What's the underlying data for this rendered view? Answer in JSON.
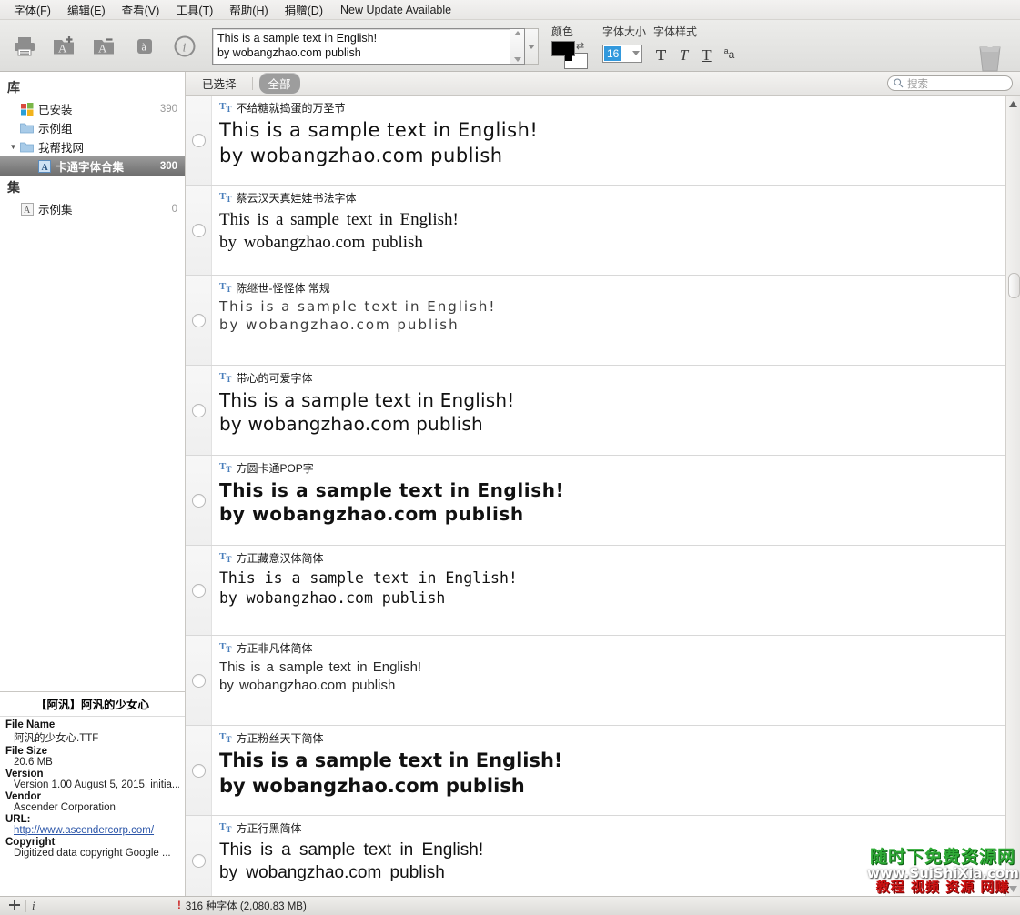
{
  "menu": {
    "items": [
      {
        "label": "字体(F)",
        "name": "menu-font"
      },
      {
        "label": "编辑(E)",
        "name": "menu-edit"
      },
      {
        "label": "查看(V)",
        "name": "menu-view"
      },
      {
        "label": "工具(T)",
        "name": "menu-tools"
      },
      {
        "label": "帮助(H)",
        "name": "menu-help"
      },
      {
        "label": "捐赠(D)",
        "name": "menu-donate"
      }
    ],
    "update_notice": "New Update Available"
  },
  "toolbar": {
    "icons": [
      {
        "name": "print-icon",
        "glyph": "print"
      },
      {
        "name": "add-font-folder-icon",
        "glyph": "folder-plus"
      },
      {
        "name": "remove-font-folder-icon",
        "glyph": "folder-minus"
      },
      {
        "name": "character-map-icon",
        "glyph": "glyph-a"
      },
      {
        "name": "info-icon",
        "glyph": "info"
      }
    ],
    "sample_input": {
      "line1": "This is a sample text in English!",
      "line2": "by wobangzhao.com  publish",
      "value": "This is a sample text in English!\nby wobangzhao.com  publish"
    },
    "color_label": "颜色",
    "color_fg": "#000000",
    "color_bg": "#ffffff",
    "size_label": "字体大小",
    "size_value": "16",
    "style_label": "字体样式",
    "style_buttons": [
      {
        "name": "bold-button",
        "label": "T"
      },
      {
        "name": "italic-button",
        "label": "T"
      },
      {
        "name": "underline-button",
        "label": "T"
      },
      {
        "name": "small-caps-button",
        "label": "a"
      }
    ],
    "trash_name": "trash-icon"
  },
  "sidebar": {
    "library_heading": "库",
    "library_items": [
      {
        "label": "已安装",
        "count": "390",
        "icon": "windows-icon",
        "indent": 1,
        "selected": false,
        "twisty": ""
      },
      {
        "label": "示例组",
        "count": "",
        "icon": "folder-icon",
        "indent": 1,
        "selected": false,
        "twisty": ""
      },
      {
        "label": "我帮找网",
        "count": "",
        "icon": "folder-icon",
        "indent": 1,
        "selected": false,
        "twisty": "▼"
      },
      {
        "label": "卡通字体合集",
        "count": "300",
        "icon": "font-file-icon",
        "indent": 2,
        "selected": true,
        "twisty": ""
      }
    ],
    "sets_heading": "集",
    "set_items": [
      {
        "label": "示例集",
        "count": "0",
        "icon": "font-set-icon",
        "indent": 1,
        "selected": false,
        "twisty": ""
      }
    ]
  },
  "info_panel": {
    "title": "【阿汎】阿汎的少女心",
    "fields": [
      {
        "key": "File Name",
        "value": "阿汎的少女心.TTF",
        "link": false
      },
      {
        "key": "File Size",
        "value": "20.6 MB",
        "link": false
      },
      {
        "key": "Version",
        "value": "Version 1.00 August 5, 2015, initia...",
        "link": false
      },
      {
        "key": "Vendor",
        "value": "Ascender Corporation",
        "link": false
      },
      {
        "key": "URL:",
        "value": "http://www.ascendercorp.com/",
        "link": true
      },
      {
        "key": "Copyright",
        "value": "Digitized data copyright Google ...",
        "link": false
      }
    ]
  },
  "content": {
    "tab_selected": "已选择",
    "tab_all": "全部",
    "search_placeholder": "搜索",
    "fonts": [
      {
        "name": "不给糖就捣蛋的万圣节",
        "preview_line1": "This is a sample text in English!",
        "preview_line2": "by wobangzhao.com  publish",
        "style": "pv-halloween"
      },
      {
        "name": "蔡云汉天真娃娃书法字体",
        "preview_line1": "This is a sample text in English!",
        "preview_line2": "by wobangzhao.com   publish",
        "style": "pv-serif"
      },
      {
        "name": "陈继世-怪怪体 常规",
        "preview_line1": "This is a sample text in English!",
        "preview_line2": "by wobangzhao.com  publish",
        "style": "pv-thin"
      },
      {
        "name": "带心的可爱字体",
        "preview_line1": "This is a sample text in English!",
        "preview_line2": "by wobangzhao.com  publish",
        "style": "pv-cute"
      },
      {
        "name": "方圆卡通POP字",
        "preview_line1": "This is a sample text in English!",
        "preview_line2": "by wobangzhao.com  publish",
        "style": "pv-pop"
      },
      {
        "name": "方正藏意汉体简体",
        "preview_line1": "This is a sample text in English!",
        "preview_line2": "by wobangzhao.com publish",
        "style": "pv-mono"
      },
      {
        "name": "方正非凡体简体",
        "preview_line1": "This is a sample text in English!",
        "preview_line2": "by wobangzhao.com   publish",
        "style": "pv-narrow"
      },
      {
        "name": "方正粉丝天下简体",
        "preview_line1": "This is a sample text in English!",
        "preview_line2": "by wobangzhao.com  publish",
        "style": "pv-bold"
      },
      {
        "name": "方正行黑简体",
        "preview_line1": "This is a sample text in English!",
        "preview_line2": "by wobangzhao.com   publish",
        "style": "pv-hei"
      }
    ]
  },
  "statusbar": {
    "add_icon": "plus-icon",
    "info_icon": "info-icon",
    "warning": "!",
    "count_text": "316 种字体 (2,080.83 MB)"
  },
  "watermark": {
    "line1": "随时下免费资源网",
    "line2": "www.SuiShiXia.com",
    "line3": "教程 视频 资源 网赚"
  }
}
